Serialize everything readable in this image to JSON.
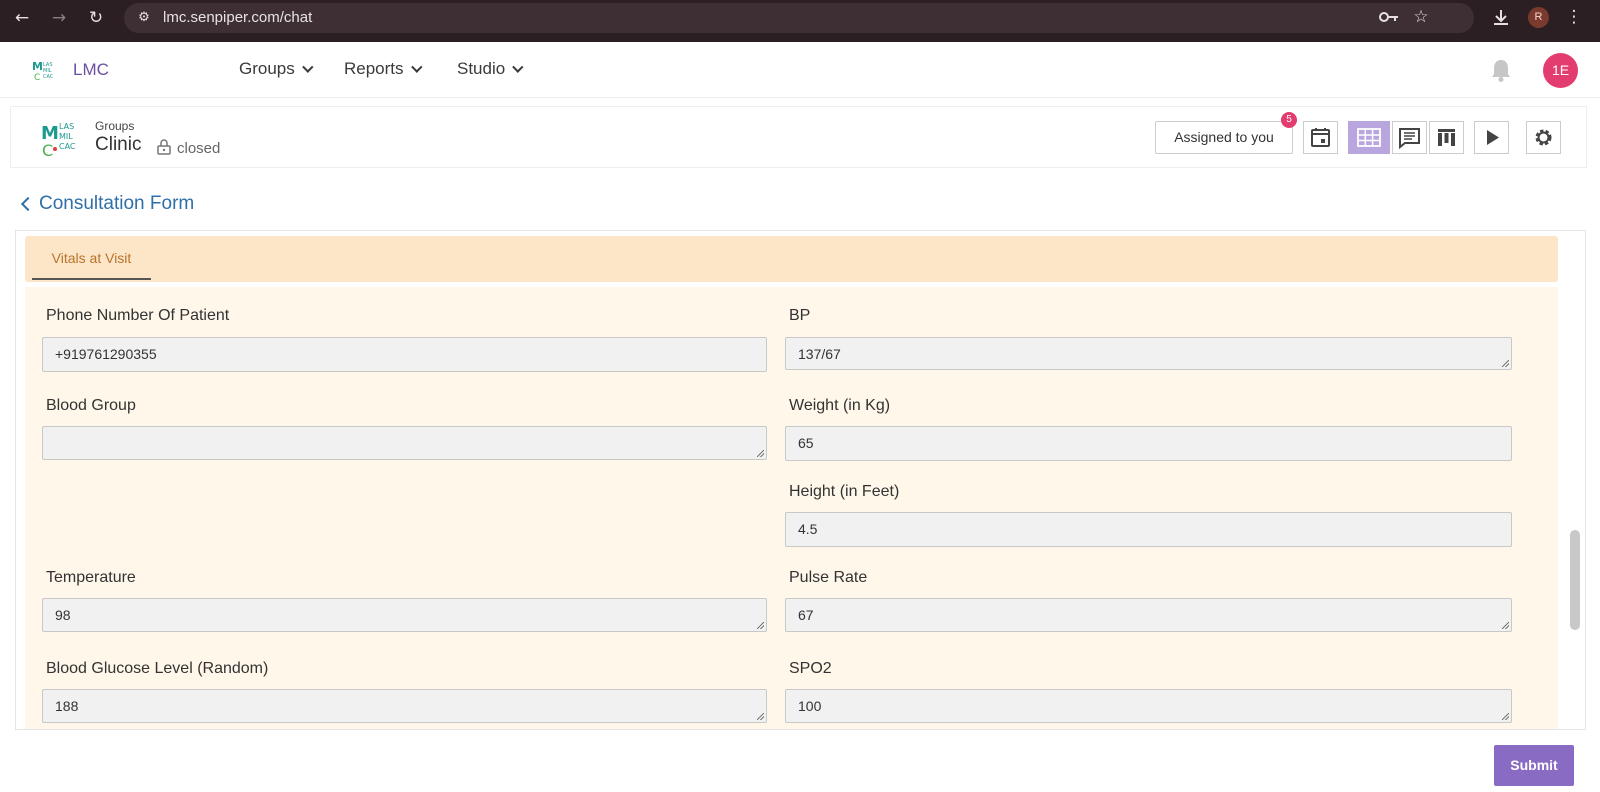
{
  "browser": {
    "url": "lmc.senpiper.com/chat",
    "profile_initial": "R"
  },
  "app": {
    "brand": "LMC",
    "avatar_initials": "1E"
  },
  "nav": {
    "menus": [
      {
        "label": "Groups"
      },
      {
        "label": "Reports"
      },
      {
        "label": "Studio"
      }
    ]
  },
  "group": {
    "label": "Groups",
    "name": "Clinic",
    "status": "closed"
  },
  "toolbar": {
    "assigned_label": "Assigned to you",
    "badge_count": "5"
  },
  "page": {
    "back_title": "Consultation Form"
  },
  "form": {
    "tab_label": "Vitals at Visit",
    "fields": {
      "phone": {
        "label": "Phone Number Of Patient",
        "value": "+919761290355"
      },
      "bp": {
        "label": "BP",
        "value": "137/67"
      },
      "blood_group": {
        "label": "Blood Group",
        "value": ""
      },
      "weight": {
        "label": "Weight (in Kg)",
        "value": "65"
      },
      "height": {
        "label": "Height (in Feet)",
        "value": "4.5"
      },
      "temperature": {
        "label": "Temperature",
        "value": "98"
      },
      "pulse": {
        "label": "Pulse Rate",
        "value": "67"
      },
      "glucose": {
        "label": "Blood Glucose Level (Random)",
        "value": "188"
      },
      "spo2": {
        "label": "SPO2",
        "value": "100"
      }
    },
    "submit_label": "Submit"
  },
  "colors": {
    "brand": "#6a4fa3",
    "avatar": "#e33c6f",
    "submit": "#8a6bc3",
    "tab_bg": "#fde5c8",
    "panel_bg": "#fff7ea"
  }
}
